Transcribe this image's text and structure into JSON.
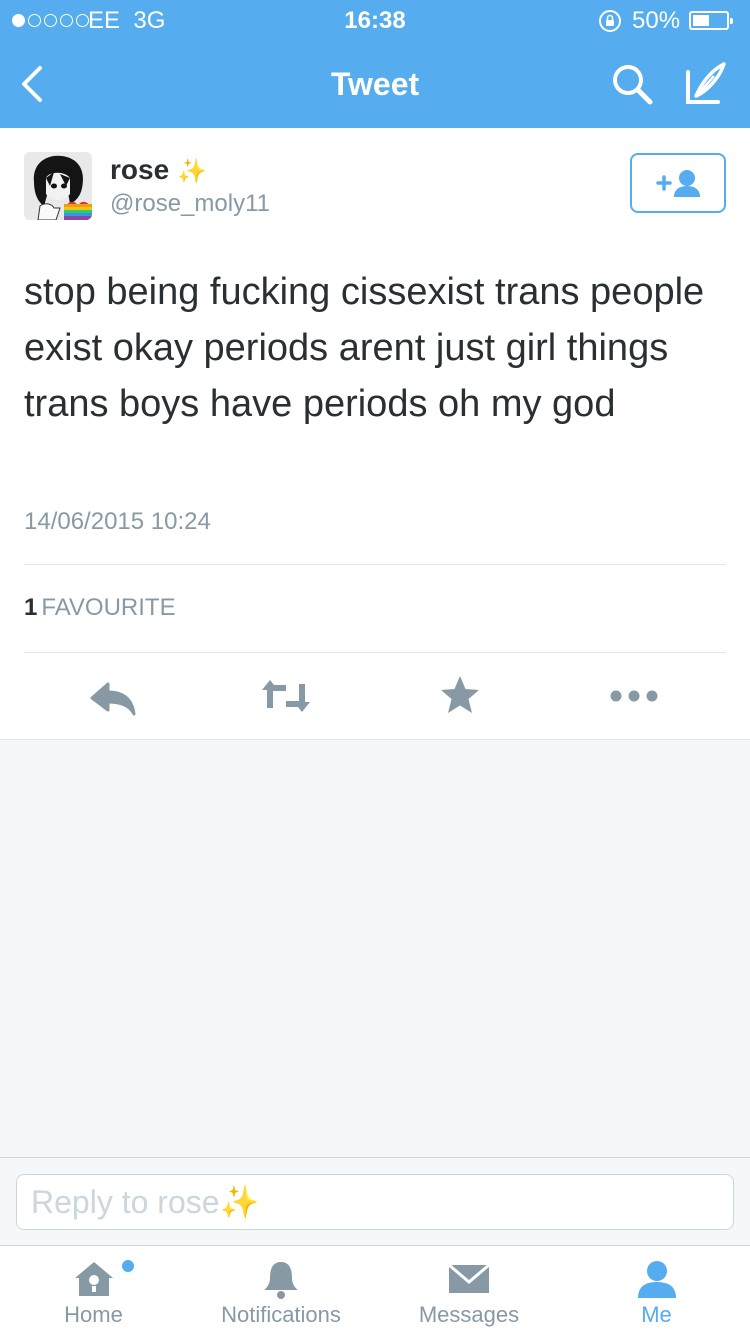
{
  "status_bar": {
    "signal_filled": 1,
    "signal_total": 5,
    "carrier": "EE  3G",
    "time": "16:38",
    "battery_percent": "50%",
    "battery_level": 0.5
  },
  "nav": {
    "title": "Tweet",
    "icons": [
      "back-chevron-icon",
      "search-icon",
      "compose-icon"
    ]
  },
  "tweet": {
    "name": "rose",
    "name_emoji": "✨",
    "handle": "@rose_moly11",
    "text": "stop being fucking cissexist trans people exist okay periods arent just girl things trans boys have periods oh my god",
    "timestamp": "14/06/2015 10:24",
    "favourites_count": "1",
    "favourites_label": "FAVOURITE",
    "actions": [
      "reply-icon",
      "retweet-icon",
      "favourite-star-icon",
      "more-icon"
    ]
  },
  "reply": {
    "placeholder": "Reply to rose✨"
  },
  "tabs": [
    {
      "label": "Home",
      "icon": "home-icon",
      "active": false,
      "has_dot": true
    },
    {
      "label": "Notifications",
      "icon": "bell-icon",
      "active": false
    },
    {
      "label": "Messages",
      "icon": "envelope-icon",
      "active": false
    },
    {
      "label": "Me",
      "icon": "person-icon",
      "active": true
    }
  ],
  "colors": {
    "accent": "#55acee",
    "muted_text": "#8899a6",
    "body_text": "#292f33",
    "background": "#f5f8fa"
  }
}
